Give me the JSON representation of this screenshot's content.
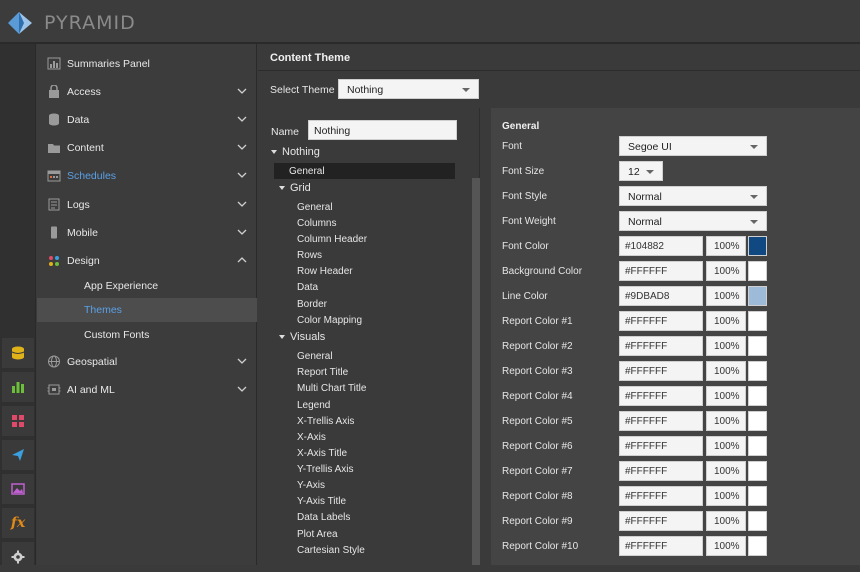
{
  "app": {
    "logo_text": "PYRAMID"
  },
  "nav": {
    "items": [
      {
        "label": "Summaries Panel",
        "icon": "summaries-panel-icon",
        "chevron": ""
      },
      {
        "label": "Access",
        "icon": "lock-icon",
        "chevron": "down"
      },
      {
        "label": "Data",
        "icon": "database-icon",
        "chevron": "down"
      },
      {
        "label": "Content",
        "icon": "folder-icon",
        "chevron": "down"
      },
      {
        "label": "Schedules",
        "icon": "calendar-icon",
        "chevron": "down"
      },
      {
        "label": "Logs",
        "icon": "logs-icon",
        "chevron": "down"
      },
      {
        "label": "Mobile",
        "icon": "mobile-icon",
        "chevron": "down"
      },
      {
        "label": "Design",
        "icon": "design-palette-icon",
        "chevron": "up"
      }
    ],
    "design_sub": [
      "App Experience",
      "Themes",
      "Custom Fonts"
    ],
    "items_after": [
      {
        "label": "Geospatial",
        "icon": "globe-icon",
        "chevron": "down"
      },
      {
        "label": "AI and ML",
        "icon": "ai-ml-icon",
        "chevron": "down"
      }
    ]
  },
  "content": {
    "title": "Content Theme",
    "select_theme_label": "Select Theme",
    "select_theme_value": "Nothing",
    "name_label": "Name",
    "name_value": "Nothing",
    "tree": {
      "root": "Nothing",
      "general": "General",
      "grid": "Grid",
      "grid_items": [
        "General",
        "Columns",
        "Column Header",
        "Rows",
        "Row Header",
        "Data",
        "Border",
        "Color Mapping"
      ],
      "visuals": "Visuals",
      "visual_items": [
        "General",
        "Report Title",
        "Multi Chart Title",
        "Legend",
        "X-Trellis Axis",
        "X-Axis",
        "X-Axis Title",
        "Y-Trellis Axis",
        "Y-Axis",
        "Y-Axis Title",
        "Data Labels",
        "Plot Area",
        "Cartesian Style"
      ]
    },
    "general": {
      "title": "General",
      "font_label": "Font",
      "font_value": "Segoe UI",
      "font_size_label": "Font Size",
      "font_size_value": "12",
      "font_style_label": "Font Style",
      "font_style_value": "Normal",
      "font_weight_label": "Font Weight",
      "font_weight_value": "Normal",
      "colors": [
        {
          "label": "Font Color",
          "hex": "#104882",
          "pct": "100%"
        },
        {
          "label": "Background Color",
          "hex": "#FFFFFF",
          "pct": "100%"
        },
        {
          "label": "Line Color",
          "hex": "#9DBAD8",
          "pct": "100%"
        },
        {
          "label": "Report Color #1",
          "hex": "#FFFFFF",
          "pct": "100%"
        },
        {
          "label": "Report Color #2",
          "hex": "#FFFFFF",
          "pct": "100%"
        },
        {
          "label": "Report Color #3",
          "hex": "#FFFFFF",
          "pct": "100%"
        },
        {
          "label": "Report Color #4",
          "hex": "#FFFFFF",
          "pct": "100%"
        },
        {
          "label": "Report Color #5",
          "hex": "#FFFFFF",
          "pct": "100%"
        },
        {
          "label": "Report Color #6",
          "hex": "#FFFFFF",
          "pct": "100%"
        },
        {
          "label": "Report Color #7",
          "hex": "#FFFFFF",
          "pct": "100%"
        },
        {
          "label": "Report Color #8",
          "hex": "#FFFFFF",
          "pct": "100%"
        },
        {
          "label": "Report Color #9",
          "hex": "#FFFFFF",
          "pct": "100%"
        },
        {
          "label": "Report Color #10",
          "hex": "#FFFFFF",
          "pct": "100%"
        }
      ]
    }
  },
  "colors": {
    "accent": "#5aa0e6",
    "active_bg": "#4d4d4d"
  }
}
